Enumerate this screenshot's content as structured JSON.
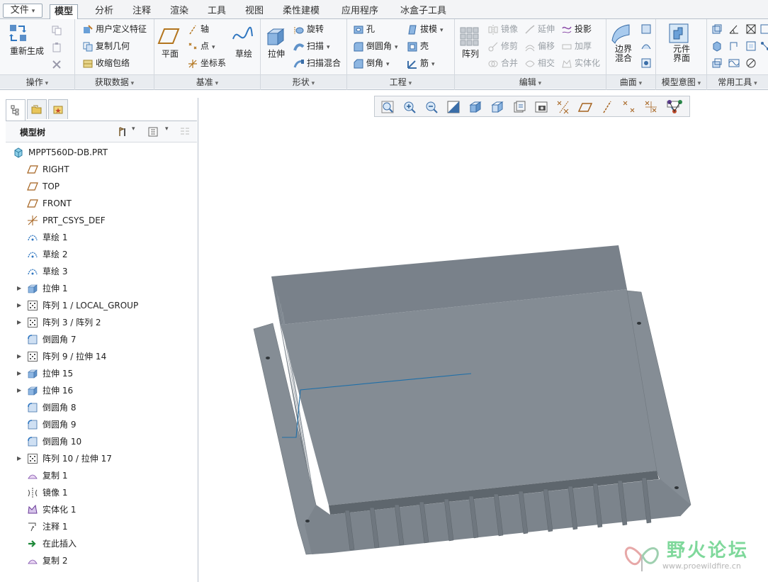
{
  "menubar": {
    "file": "文件",
    "tabs": [
      "模型",
      "分析",
      "注释",
      "渲染",
      "工具",
      "视图",
      "柔性建模",
      "应用程序",
      "冰盒子工具"
    ],
    "active": "模型"
  },
  "ribbon": {
    "operations": {
      "label": "操作",
      "regen": "重新生成"
    },
    "getdata": {
      "label": "获取数据",
      "items": [
        "用户定义特征",
        "复制几何",
        "收缩包络"
      ]
    },
    "datum": {
      "label": "基准",
      "plane": "平面",
      "axis": "轴",
      "point": "点",
      "csys": "坐标系",
      "sketch": "草绘"
    },
    "shape": {
      "label": "形状",
      "extrude": "拉伸",
      "revolve": "旋转",
      "sweep": "扫描",
      "swept_blend": "扫描混合"
    },
    "engineering": {
      "label": "工程",
      "hole": "孔",
      "round": "倒圆角",
      "chamfer": "倒角",
      "draft": "拔模",
      "shell": "壳",
      "rib": "筋"
    },
    "editing": {
      "label": "编辑",
      "pattern": "阵列",
      "mirror": "镜像",
      "trim": "修剪",
      "merge": "合并",
      "extend": "延伸",
      "offset": "偏移",
      "intersect": "相交",
      "project": "投影",
      "thicken": "加厚",
      "solidify": "实体化"
    },
    "surfaces": {
      "label": "曲面",
      "boundary": "边界混合"
    },
    "intent": {
      "label": "模型意图",
      "component": "元件界面"
    },
    "common": {
      "label": "常用工具"
    }
  },
  "tree": {
    "title": "模型树",
    "root": "MPPT560D-DB.PRT",
    "items": [
      {
        "label": "RIGHT",
        "icon": "datum-plane-icon",
        "expand": false
      },
      {
        "label": "TOP",
        "icon": "datum-plane-icon",
        "expand": false
      },
      {
        "label": "FRONT",
        "icon": "datum-plane-icon",
        "expand": false
      },
      {
        "label": "PRT_CSYS_DEF",
        "icon": "csys-icon",
        "expand": false
      },
      {
        "label": "草绘 1",
        "icon": "sketch-icon",
        "expand": false
      },
      {
        "label": "草绘 2",
        "icon": "sketch-icon",
        "expand": false
      },
      {
        "label": "草绘 3",
        "icon": "sketch-icon",
        "expand": false
      },
      {
        "label": "拉伸 1",
        "icon": "extrude-icon",
        "expand": true
      },
      {
        "label": "阵列 1 / LOCAL_GROUP",
        "icon": "pattern-icon",
        "expand": true
      },
      {
        "label": "阵列 3 / 阵列 2",
        "icon": "pattern-icon",
        "expand": true
      },
      {
        "label": "倒圆角 7",
        "icon": "round-icon",
        "expand": false
      },
      {
        "label": "阵列 9 / 拉伸 14",
        "icon": "pattern-icon",
        "expand": true
      },
      {
        "label": "拉伸 15",
        "icon": "extrude-icon",
        "expand": true
      },
      {
        "label": "拉伸 16",
        "icon": "extrude-icon",
        "expand": true
      },
      {
        "label": "倒圆角 8",
        "icon": "round-icon",
        "expand": false
      },
      {
        "label": "倒圆角 9",
        "icon": "round-icon",
        "expand": false
      },
      {
        "label": "倒圆角 10",
        "icon": "round-icon",
        "expand": false
      },
      {
        "label": "阵列 10 / 拉伸 17",
        "icon": "pattern-icon",
        "expand": true
      },
      {
        "label": "复制 1",
        "icon": "copy-surface-icon",
        "expand": false
      },
      {
        "label": "镜像 1",
        "icon": "mirror-icon",
        "expand": false
      },
      {
        "label": "实体化 1",
        "icon": "solidify-icon",
        "expand": false
      },
      {
        "label": "注释 1",
        "icon": "note-icon",
        "expand": false
      },
      {
        "label": "在此插入",
        "icon": "insert-arrow-icon",
        "expand": false
      },
      {
        "label": "复制 2",
        "icon": "copy-surface-icon",
        "expand": false
      }
    ]
  },
  "watermark": {
    "name": "野火论坛",
    "url": "www.proewildfire.cn"
  },
  "colors": {
    "model": "#7f878f",
    "model_top": "#878f98",
    "model_dark": "#5e666d",
    "highlight": "#1f6fa8",
    "accent": "#2f76c0"
  }
}
